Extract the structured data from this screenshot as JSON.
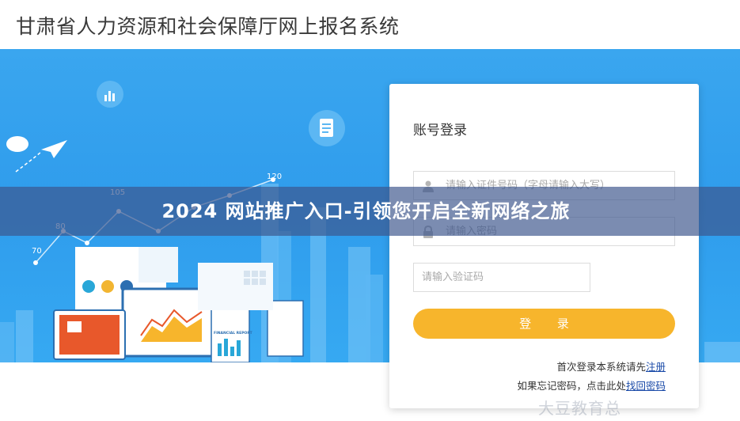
{
  "header": {
    "title": "甘肃省人力资源和社会保障厅网上报名系统"
  },
  "hero": {
    "chart_numbers": [
      "120",
      "105",
      "80",
      "70"
    ],
    "report_label": "FINANCIAL REPORT",
    "colors": {
      "background": "#2f9cec",
      "accent_orange": "#f7b52c",
      "report_red": "#e8582b"
    }
  },
  "login": {
    "title": "账号登录",
    "id_placeholder": "请输入证件号码（字母请输入大写）",
    "password_placeholder": "请输入密码",
    "captcha_placeholder": "请输入验证码",
    "login_button": "登 录",
    "first_login_text": "首次登录本系统请先",
    "register_link": "注册",
    "forgot_text": "如果忘记密码，点击此处",
    "recover_link": "找回密码"
  },
  "banner": {
    "text": "2024 网站推广入口-引领您开启全新网络之旅"
  },
  "watermark": {
    "text": "大豆教育总"
  }
}
